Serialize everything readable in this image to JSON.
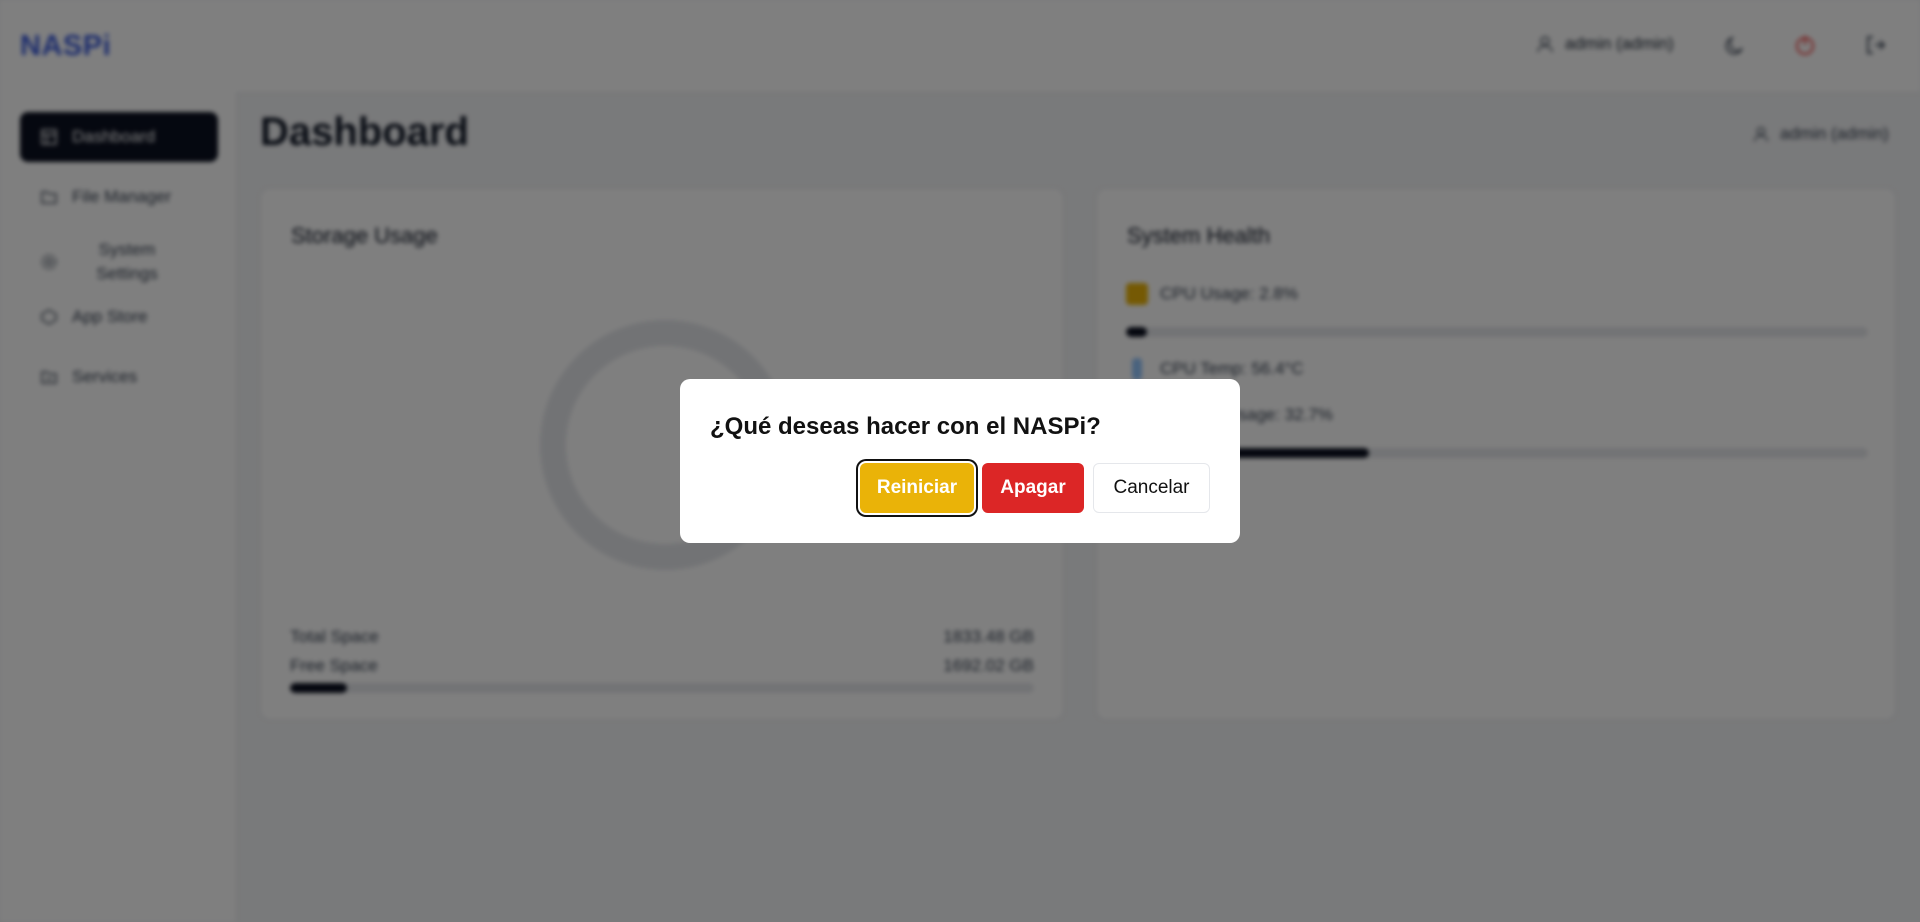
{
  "header": {
    "logo": "NASPi",
    "user": "admin (admin)"
  },
  "sidebar": {
    "items": [
      {
        "label": "Dashboard",
        "active": true
      },
      {
        "label": "File Manager"
      },
      {
        "label": "System Settings"
      },
      {
        "label": "App Store"
      },
      {
        "label": "Services"
      }
    ]
  },
  "main": {
    "title": "Dashboard",
    "user": "admin (admin)",
    "storage": {
      "title": "Storage Usage",
      "total_label": "Total Space",
      "total_value": "1833.48 GB",
      "free_label": "Free Space",
      "free_value": "1692.02 GB",
      "used_fraction": 0.077
    },
    "health": {
      "title": "System Health",
      "cpu_usage": "CPU Usage: 2.8%",
      "cpu_usage_fraction": 0.028,
      "cpu_temp": "CPU Temp: 56.4°C",
      "memory": "Memory Usage: 32.7%",
      "memory_fraction": 0.327
    }
  },
  "dialog": {
    "title": "¿Qué deseas hacer con el NASPi?",
    "restart_label": "Reiniciar",
    "shutdown_label": "Apagar",
    "cancel_label": "Cancelar"
  },
  "colors": {
    "accent": "#0b1020",
    "logo": "#3b5bdb",
    "restart": "#eab308",
    "shutdown": "#dc2626"
  }
}
